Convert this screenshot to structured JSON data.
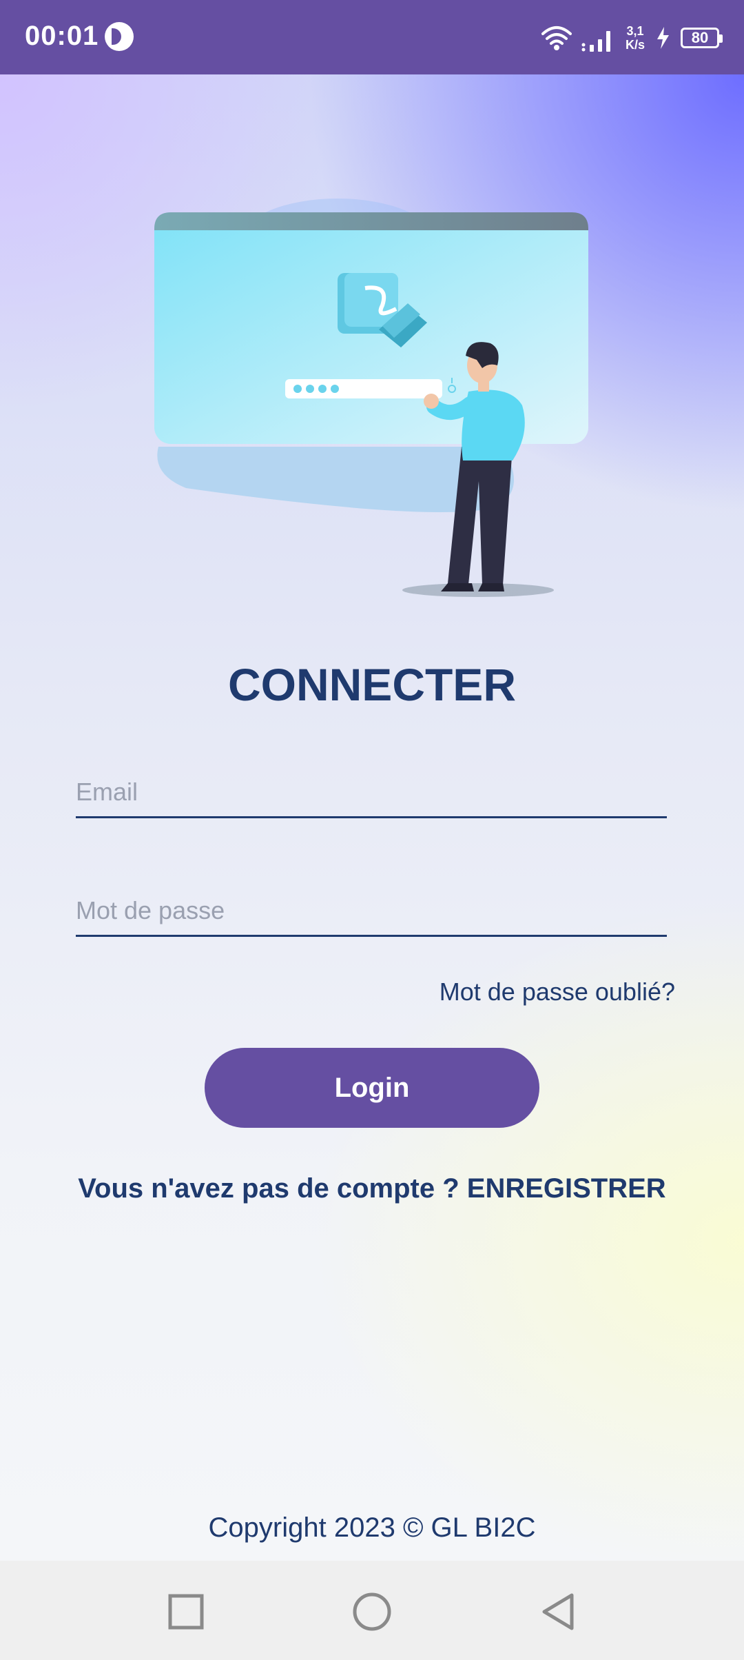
{
  "status_bar": {
    "time": "00:01",
    "net_speed_value": "3,1",
    "net_speed_unit": "K/s",
    "battery": "80",
    "icons": [
      "app-notification-icon",
      "wifi-icon",
      "signal-icon",
      "charging-bolt-icon",
      "battery-icon"
    ]
  },
  "illustration": {
    "icon": "login-illustration",
    "password_dots": "••••"
  },
  "login": {
    "title": "CONNECTER",
    "email_placeholder": "Email",
    "password_placeholder": "Mot de passe",
    "forgot_password": "Mot de passe oublié?",
    "login_button": "Login",
    "register_prompt": "Vous n'avez pas de compte ? ENREGISTRER"
  },
  "footer": {
    "copyright": "Copyright 2023 © GL BI2C"
  },
  "nav_bar": {
    "buttons": [
      "recents-icon",
      "home-icon",
      "back-icon"
    ]
  },
  "colors": {
    "primary": "#654fa2",
    "text": "#1f3a6e",
    "nav_bg": "#efefef"
  }
}
